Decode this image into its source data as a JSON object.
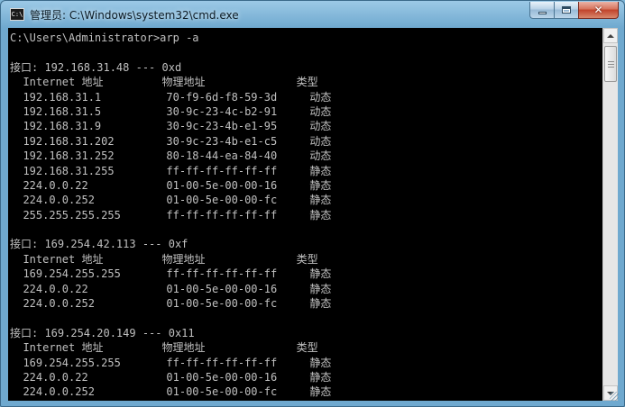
{
  "window": {
    "title": "管理员: C:\\Windows\\system32\\cmd.exe",
    "icon_text": "C:\\",
    "icon": "console-icon",
    "buttons": {
      "minimize": "minimize-icon",
      "maximize": "maximize-icon",
      "close": "close-icon"
    },
    "close_glyph": "✕"
  },
  "console": {
    "lines": [
      "C:\\Users\\Administrator>arp -a",
      "",
      "接口: 192.168.31.48 --- 0xd",
      "  Internet 地址         物理地址              类型",
      "  192.168.31.1          70-f9-6d-f8-59-3d     动态",
      "  192.168.31.5          30-9c-23-4c-b2-91     动态",
      "  192.168.31.9          30-9c-23-4b-e1-95     动态",
      "  192.168.31.202        30-9c-23-4b-e1-c5     动态",
      "  192.168.31.252        80-18-44-ea-84-40     动态",
      "  192.168.31.255        ff-ff-ff-ff-ff-ff     静态",
      "  224.0.0.22            01-00-5e-00-00-16     静态",
      "  224.0.0.252           01-00-5e-00-00-fc     静态",
      "  255.255.255.255       ff-ff-ff-ff-ff-ff     静态",
      "",
      "接口: 169.254.42.113 --- 0xf",
      "  Internet 地址         物理地址              类型",
      "  169.254.255.255       ff-ff-ff-ff-ff-ff     静态",
      "  224.0.0.22            01-00-5e-00-00-16     静态",
      "  224.0.0.252           01-00-5e-00-00-fc     静态",
      "",
      "接口: 169.254.20.149 --- 0x11",
      "  Internet 地址         物理地址              类型",
      "  169.254.255.255       ff-ff-ff-ff-ff-ff     静态",
      "  224.0.0.22            01-00-5e-00-00-16     静态",
      "  224.0.0.252           01-00-5e-00-00-fc     静态"
    ]
  },
  "colors": {
    "console_bg": "#000000",
    "console_fg": "#c0c0c0",
    "titlebar": "#6fa9cf",
    "close_button": "#c1432b"
  }
}
